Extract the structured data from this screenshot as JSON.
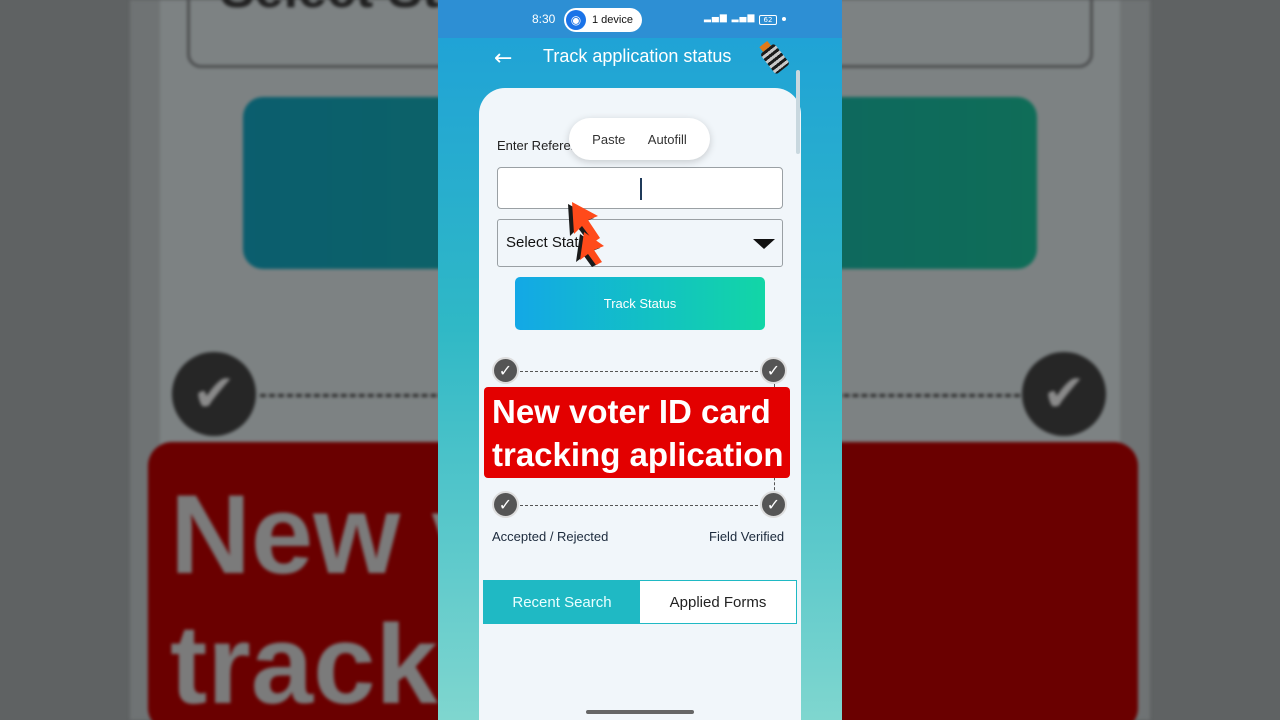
{
  "status_bar": {
    "time": "8:30",
    "hotspot_label": "1 device",
    "battery": "62"
  },
  "app_bar": {
    "title": "Track application status",
    "icon": "voting-ink-icon"
  },
  "context_menu": {
    "items": [
      "Paste",
      "Autofill"
    ]
  },
  "form": {
    "reference_label": "Enter Reference ID",
    "reference_value": "",
    "state_select_value": "Select State",
    "submit_label": "Track Status"
  },
  "banner": {
    "line1": "New voter ID card",
    "line2": "tracking aplication",
    "color": "#e30000"
  },
  "steps": {
    "left_label": "Accepted / Rejected",
    "right_label": "Field Verified"
  },
  "tabs": [
    {
      "label": "Recent Search",
      "active": true
    },
    {
      "label": "Applied Forms",
      "active": false
    }
  ],
  "background_copy": {
    "top_text": "Select St",
    "line1": "New v          card",
    "line2": "tracki         cation"
  },
  "colors": {
    "accent": "#1fb9c4",
    "button_start": "#13a8e6",
    "button_end": "#12d6a6"
  }
}
